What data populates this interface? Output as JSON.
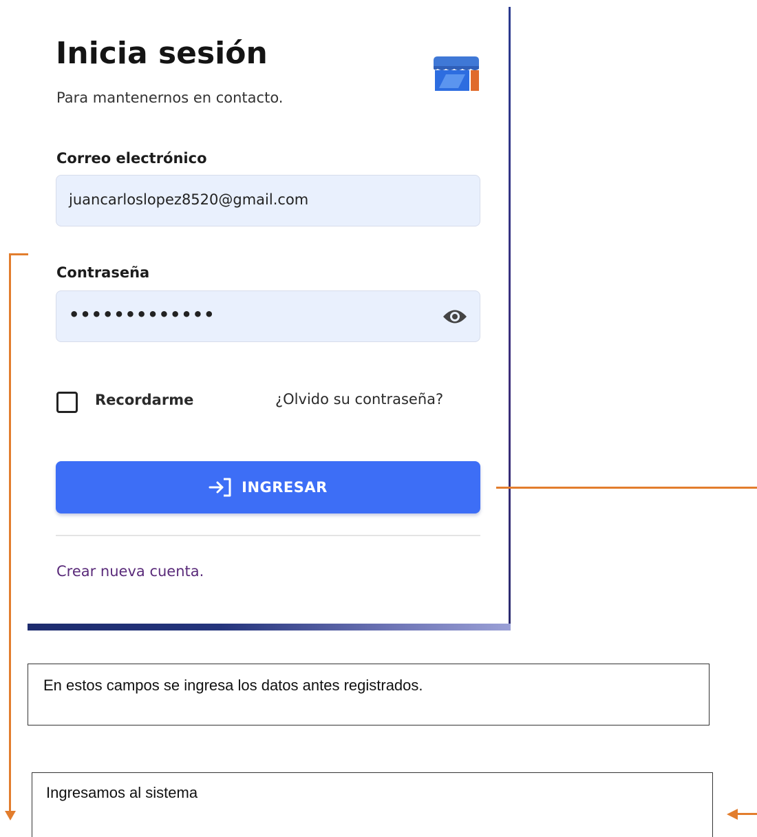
{
  "login": {
    "title": "Inicia sesión",
    "subtitle": "Para mantenernos en contacto.",
    "brand_icon": "store-icon",
    "email": {
      "label": "Correo electrónico",
      "value": "juancarloslopez8520@gmail.com"
    },
    "password": {
      "label": "Contraseña",
      "masked_value": "•••••••••••••",
      "toggle_icon": "eye-icon"
    },
    "remember_label": "Recordarme",
    "remember_checked": false,
    "forgot_label": "¿Olvido su contraseña?",
    "submit": {
      "label": "INGRESAR",
      "icon": "login-icon"
    },
    "create_account": "Crear nueva cuenta."
  },
  "annotations": {
    "fields_note": "En estos campos se ingresa los datos antes registrados.",
    "button_note": "Ingresamos al sistema"
  },
  "colors": {
    "button": "#3d6ef6",
    "input_bg": "#e9f0fd",
    "annotation_line": "#e27d2d",
    "link": "#5a2b7a"
  }
}
